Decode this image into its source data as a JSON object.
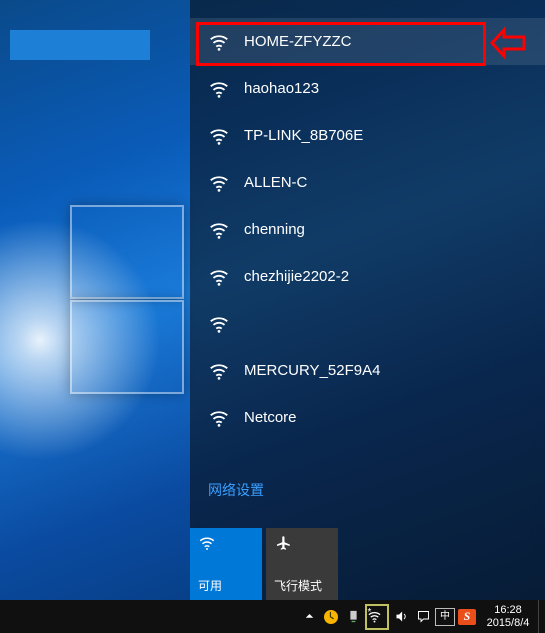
{
  "networks": [
    {
      "name": "HOME-ZFYZZC",
      "selected": true
    },
    {
      "name": "haohao123",
      "selected": false
    },
    {
      "name": "TP-LINK_8B706E",
      "selected": false
    },
    {
      "name": "ALLEN-C",
      "selected": false
    },
    {
      "name": "chenning",
      "selected": false
    },
    {
      "name": "chezhijie2202-2",
      "selected": false
    },
    {
      "name": "",
      "selected": false
    },
    {
      "name": "MERCURY_52F9A4",
      "selected": false
    },
    {
      "name": "Netcore",
      "selected": false
    }
  ],
  "settings_label": "网络设置",
  "tiles": {
    "wifi": {
      "label": "可用"
    },
    "airplane": {
      "label": "飞行模式"
    }
  },
  "tray": {
    "ime": "中",
    "sogou": "S",
    "time": "16:28",
    "date": "2015/8/4",
    "net_badge": "*"
  }
}
